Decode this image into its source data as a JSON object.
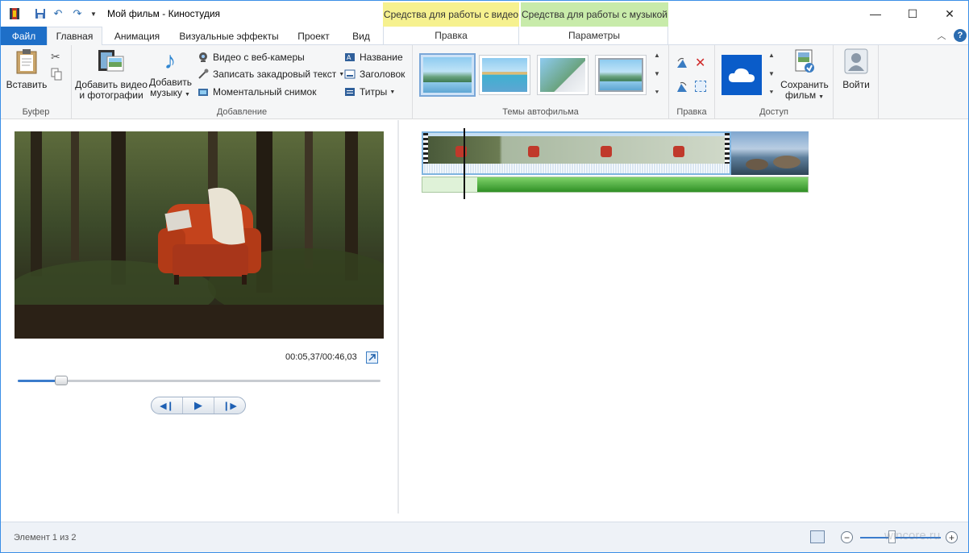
{
  "window": {
    "title": "Мой фильм - Киностудия",
    "contextual_tabs": {
      "video_tools": "Средства для работы с видео",
      "music_tools": "Средства для работы с музыкой"
    },
    "controls": {
      "minimize": "—",
      "maximize": "☐",
      "close": "✕"
    }
  },
  "tabs": [
    "Файл",
    "Главная",
    "Анимация",
    "Визуальные эффекты",
    "Проект",
    "Вид"
  ],
  "contextual_labels": {
    "edit": "Правка",
    "options": "Параметры"
  },
  "ribbon": {
    "clipboard": {
      "label": "Буфер",
      "paste": "Вставить"
    },
    "add": {
      "label": "Добавление",
      "add_videos_photos": [
        "Добавить видео",
        "и фотографии"
      ],
      "add_music": [
        "Добавить",
        "музыку"
      ],
      "webcam_video": "Видео с веб-камеры",
      "record_narration": "Записать закадровый текст",
      "snapshot": "Моментальный снимок",
      "title": "Название",
      "caption": "Заголовок",
      "credits": "Титры"
    },
    "themes": {
      "label": "Темы автофильма"
    },
    "editing": {
      "label": "Правка"
    },
    "share": {
      "label": "Доступ",
      "save_movie": [
        "Сохранить",
        "фильм"
      ]
    },
    "signin": {
      "label": "Войти"
    }
  },
  "preview": {
    "time": "00:05,37/00:46,03",
    "progress": 0.12
  },
  "status": {
    "text": "Элемент 1 из 2",
    "zoom_level": 0.4
  },
  "watermark": "wincore.ru"
}
